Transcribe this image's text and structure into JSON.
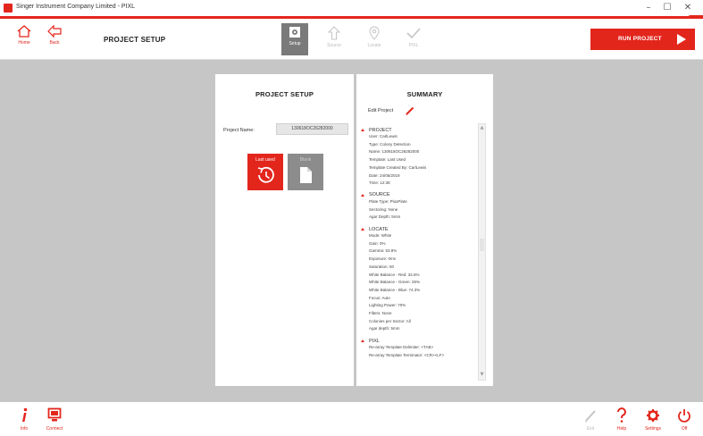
{
  "window": {
    "title": "Singer Instrument Company Limited - PIXL",
    "minimize": "–",
    "maximize": "☐",
    "close": "✕"
  },
  "toolbar": {
    "home_label": "Home",
    "back_label": "Back",
    "page_title": "PROJECT SETUP",
    "steps": [
      {
        "label": "Setup",
        "active": true
      },
      {
        "label": "Source",
        "active": false
      },
      {
        "label": "Locate",
        "active": false
      },
      {
        "label": "PIXL",
        "active": false
      }
    ],
    "run_label": "RUN PROJECT"
  },
  "setup_panel": {
    "title": "PROJECT SETUP",
    "name_label": "Project Name:",
    "name_value": "130618OC26282000",
    "last_used_label": "Last used",
    "blank_label": "Blank"
  },
  "summary_panel": {
    "title": "SUMMARY",
    "edit_label": "Edit Project",
    "sections": [
      {
        "heading": "PROJECT",
        "lines": [
          "User: CarlLewis",
          "Type: Colony Detection",
          "Name: 130618OC26282000",
          "Template: Last Used",
          "Template Created By: CarlLewis",
          "Date: 24/06/2019",
          "Time: 12:38"
        ]
      },
      {
        "heading": "SOURCE",
        "lines": [
          "Plate Type: PlusPlate",
          "Sectoring: None",
          "Agar Depth: 5mm"
        ]
      },
      {
        "heading": "LOCATE",
        "lines": [
          "Mode: White",
          "Gain: 0%",
          "Gamma: 53.8%",
          "Exposure: 0ms",
          "Saturation: 50",
          "White Balance - Red: 34.6%",
          "White Balance - Green: 25%",
          "White Balance - Blue: 74.3%",
          "Focus: Auto",
          "Lighting Power: 70%",
          "Filters: None",
          "Colonies per Sector: All",
          "Agar depth: 5mm"
        ]
      },
      {
        "heading": "PIXL",
        "lines": [
          "Re-array Template Delimiter: <TAB>",
          "Re-array Template Terminator: <CR><LF>"
        ]
      }
    ]
  },
  "bottombar": {
    "info_label": "Info",
    "connect_label": "Connect",
    "exit_label": "Exit",
    "help_label": "Help",
    "settings_label": "Settings",
    "off_label": "Off"
  },
  "colors": {
    "accent": "#e3261c",
    "background": "#c6c6c6",
    "active_step": "#7a7a7a",
    "disabled": "#bbbbbb"
  },
  "icons": {
    "home": "home-icon",
    "back": "back-arrow-icon",
    "setup": "camera-settings-icon",
    "source": "upload-arrow-icon",
    "locate": "location-pin-icon",
    "pixl": "checkmark-icon",
    "run": "play-icon",
    "last_used": "history-clock-icon",
    "blank": "blank-document-icon",
    "edit": "pencil-icon",
    "info": "info-icon",
    "connect": "monitor-icon",
    "exit": "pencil-icon",
    "help": "question-icon",
    "settings": "gear-icon",
    "off": "power-icon"
  }
}
